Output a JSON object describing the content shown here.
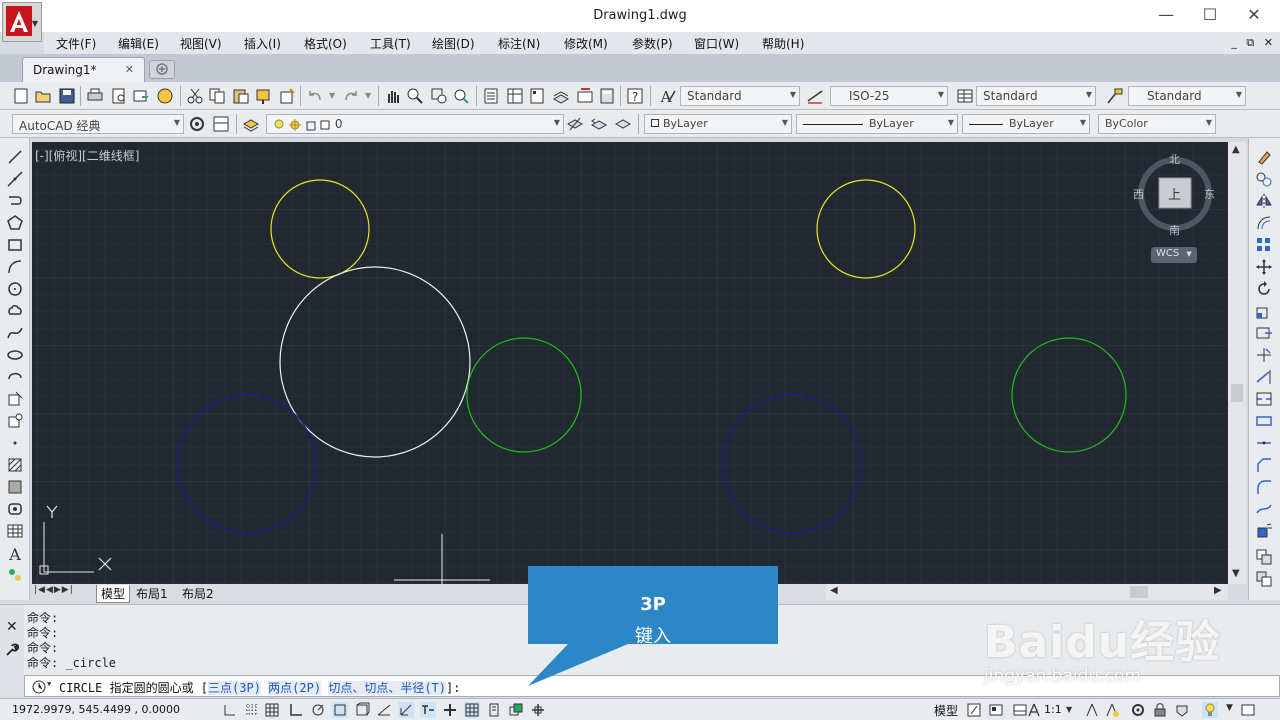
{
  "window": {
    "title": "Drawing1.dwg",
    "minimize": "—",
    "maximize": "☐",
    "close": "✕",
    "app_logo": "autocad-logo"
  },
  "menu": {
    "items": [
      "文件(F)",
      "编辑(E)",
      "视图(V)",
      "插入(I)",
      "格式(O)",
      "工具(T)",
      "绘图(D)",
      "标注(N)",
      "修改(M)",
      "参数(P)",
      "窗口(W)",
      "帮助(H)"
    ],
    "mdi_controls": "_ ⧉ ✕"
  },
  "tabs": {
    "document": "Drawing1*",
    "close": "✕"
  },
  "toolbar1": {
    "text_style": "Standard",
    "dim_style": "ISO-25",
    "table_style": "Standard",
    "multileader_style": "Standard"
  },
  "toolbar2": {
    "workspace": "AutoCAD 经典",
    "layer": "0",
    "color": "ByLayer",
    "linetype": "ByLayer",
    "lineweight": "ByLayer",
    "plotstyle": "ByColor"
  },
  "viewport": {
    "label": "[-][俯视][二维线框]"
  },
  "viewcube": {
    "north": "北",
    "south": "南",
    "east": "东",
    "west": "西",
    "face": "上",
    "wcs": "WCS"
  },
  "ucs": {
    "x": "X",
    "y": "Y"
  },
  "layout_tabs": {
    "nav": "|◀◀▶▶|",
    "items": [
      "模型",
      "布局1",
      "布局2"
    ]
  },
  "command": {
    "history": [
      "命令:",
      "命令:",
      "命令:",
      "命令: _circle"
    ],
    "prompt_prefix": "CIRCLE 指定圆的圆心或 [",
    "opt1": "三点(3P)",
    "opt2": "两点(2P)",
    "opt3": "切点、切点、半径(T)",
    "prompt_suffix": "]:"
  },
  "callout": {
    "text_prefix": "键入 ",
    "text_bold": "3P"
  },
  "watermark": {
    "brand": "Baidu经验",
    "url": "jingyan.baidu.com"
  },
  "status": {
    "coords": "1972.9979, 545.4499 , 0.0000",
    "model": "模型",
    "scale": "1:1"
  },
  "colors": {
    "canvas": "#212830",
    "yellow_circle": "#e8e820",
    "white_circle": "#f0f0f0",
    "green_circle": "#20c020",
    "blue_circle": "#1a1a9a",
    "callout": "#2d86c6"
  }
}
